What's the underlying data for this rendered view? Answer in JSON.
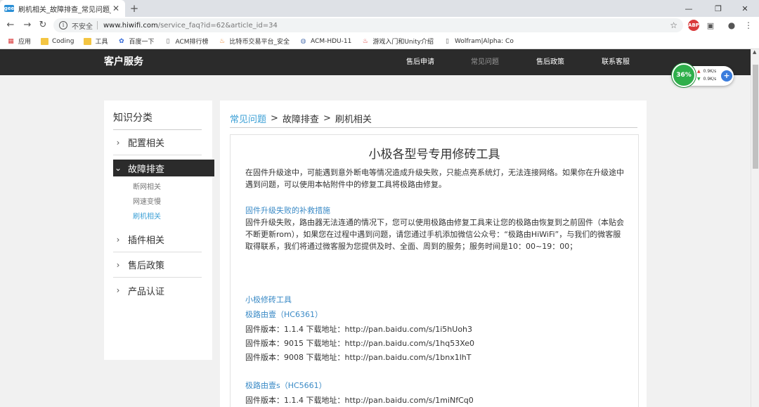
{
  "browser": {
    "tab": {
      "favicon": "gee",
      "title": "刷机相关_故障排查_常见问题_极"
    },
    "url": {
      "security_label": "不安全",
      "host": "www.hiwifi.com",
      "path": "/service_faq?id=62&article_id=34"
    },
    "ext_icons": {
      "abp": "ABP"
    }
  },
  "bookmarks": [
    {
      "label": "应用",
      "icon": "apps-grid-icon"
    },
    {
      "label": "Coding",
      "icon": "folder-icon"
    },
    {
      "label": "工具",
      "icon": "folder-icon"
    },
    {
      "label": "百度一下",
      "icon": "paw-icon"
    },
    {
      "label": "ACM排行榜",
      "icon": "page-icon"
    },
    {
      "label": "比特币交易平台_安全",
      "icon": "flame-icon"
    },
    {
      "label": "ACM-HDU-11",
      "icon": "globe-icon"
    },
    {
      "label": "游戏入门和Unity介绍",
      "icon": "flame-icon"
    },
    {
      "label": "Wolfram|Alpha: Co",
      "icon": "page-icon"
    }
  ],
  "site": {
    "brand": "客户服务",
    "nav": [
      "售后申请",
      "常见问题",
      "售后政策",
      "联系客服"
    ]
  },
  "sidebar": {
    "title": "知识分类",
    "items": [
      {
        "label": "配置相关"
      },
      {
        "label": "故障排查"
      },
      {
        "label": "插件相关"
      },
      {
        "label": "售后政策"
      },
      {
        "label": "产品认证"
      }
    ],
    "sub_items": [
      "断网相关",
      "网速变慢",
      "刷机相关"
    ]
  },
  "breadcrumb": [
    "常见问题",
    "故障排查",
    "刷机相关"
  ],
  "article": {
    "title": "小极各型号专用修砖工具",
    "intro": "在固件升级途中，可能遇到意外断电等情况造成升级失败，只能点亮系统灯，无法连接网络。如果你在升级途中遇到问题，可以使用本帖附件中的修复工具将极路由修复。",
    "rescue_heading": "固件升级失败的补救措施",
    "rescue_body": "固件升级失败，路由器无法连通的情况下，您可以使用极路由修复工具来让您的极路由恢复到之前固件（本贴会不断更新rom），如果您在过程中遇到问题，请您通过手机添加微信公众号：“极路由HiWiFi”，与我们的微客服取得联系，我们将通过微客服为您提供及时、全面、周到的服务；服务时间是10：00~19：00；",
    "tools_heading": "小极修砖工具",
    "models": [
      {
        "name": "极路由壹（HC6361）",
        "downloads": [
          "固件版本：1.1.4  下载地址：http://pan.baidu.com/s/1i5hUoh3",
          "固件版本：9015   下载地址：http://pan.baidu.com/s/1hq53Xe0",
          "固件版本：9008   下载地址：http://pan.baidu.com/s/1bnx1lhT"
        ]
      },
      {
        "name": "极路由壹s（HC5661）",
        "downloads": [
          "固件版本：1.1.4  下载地址：http://pan.baidu.com/s/1miNfCq0"
        ]
      }
    ]
  },
  "widget": {
    "percent": "36%",
    "up": "0.9K/s",
    "down": "0.9K/s"
  },
  "colors": {
    "header_bg": "#2b2b2b",
    "accent": "#3ca0d6",
    "link": "#3a8ac6",
    "gauge": "#2eaf4a"
  }
}
